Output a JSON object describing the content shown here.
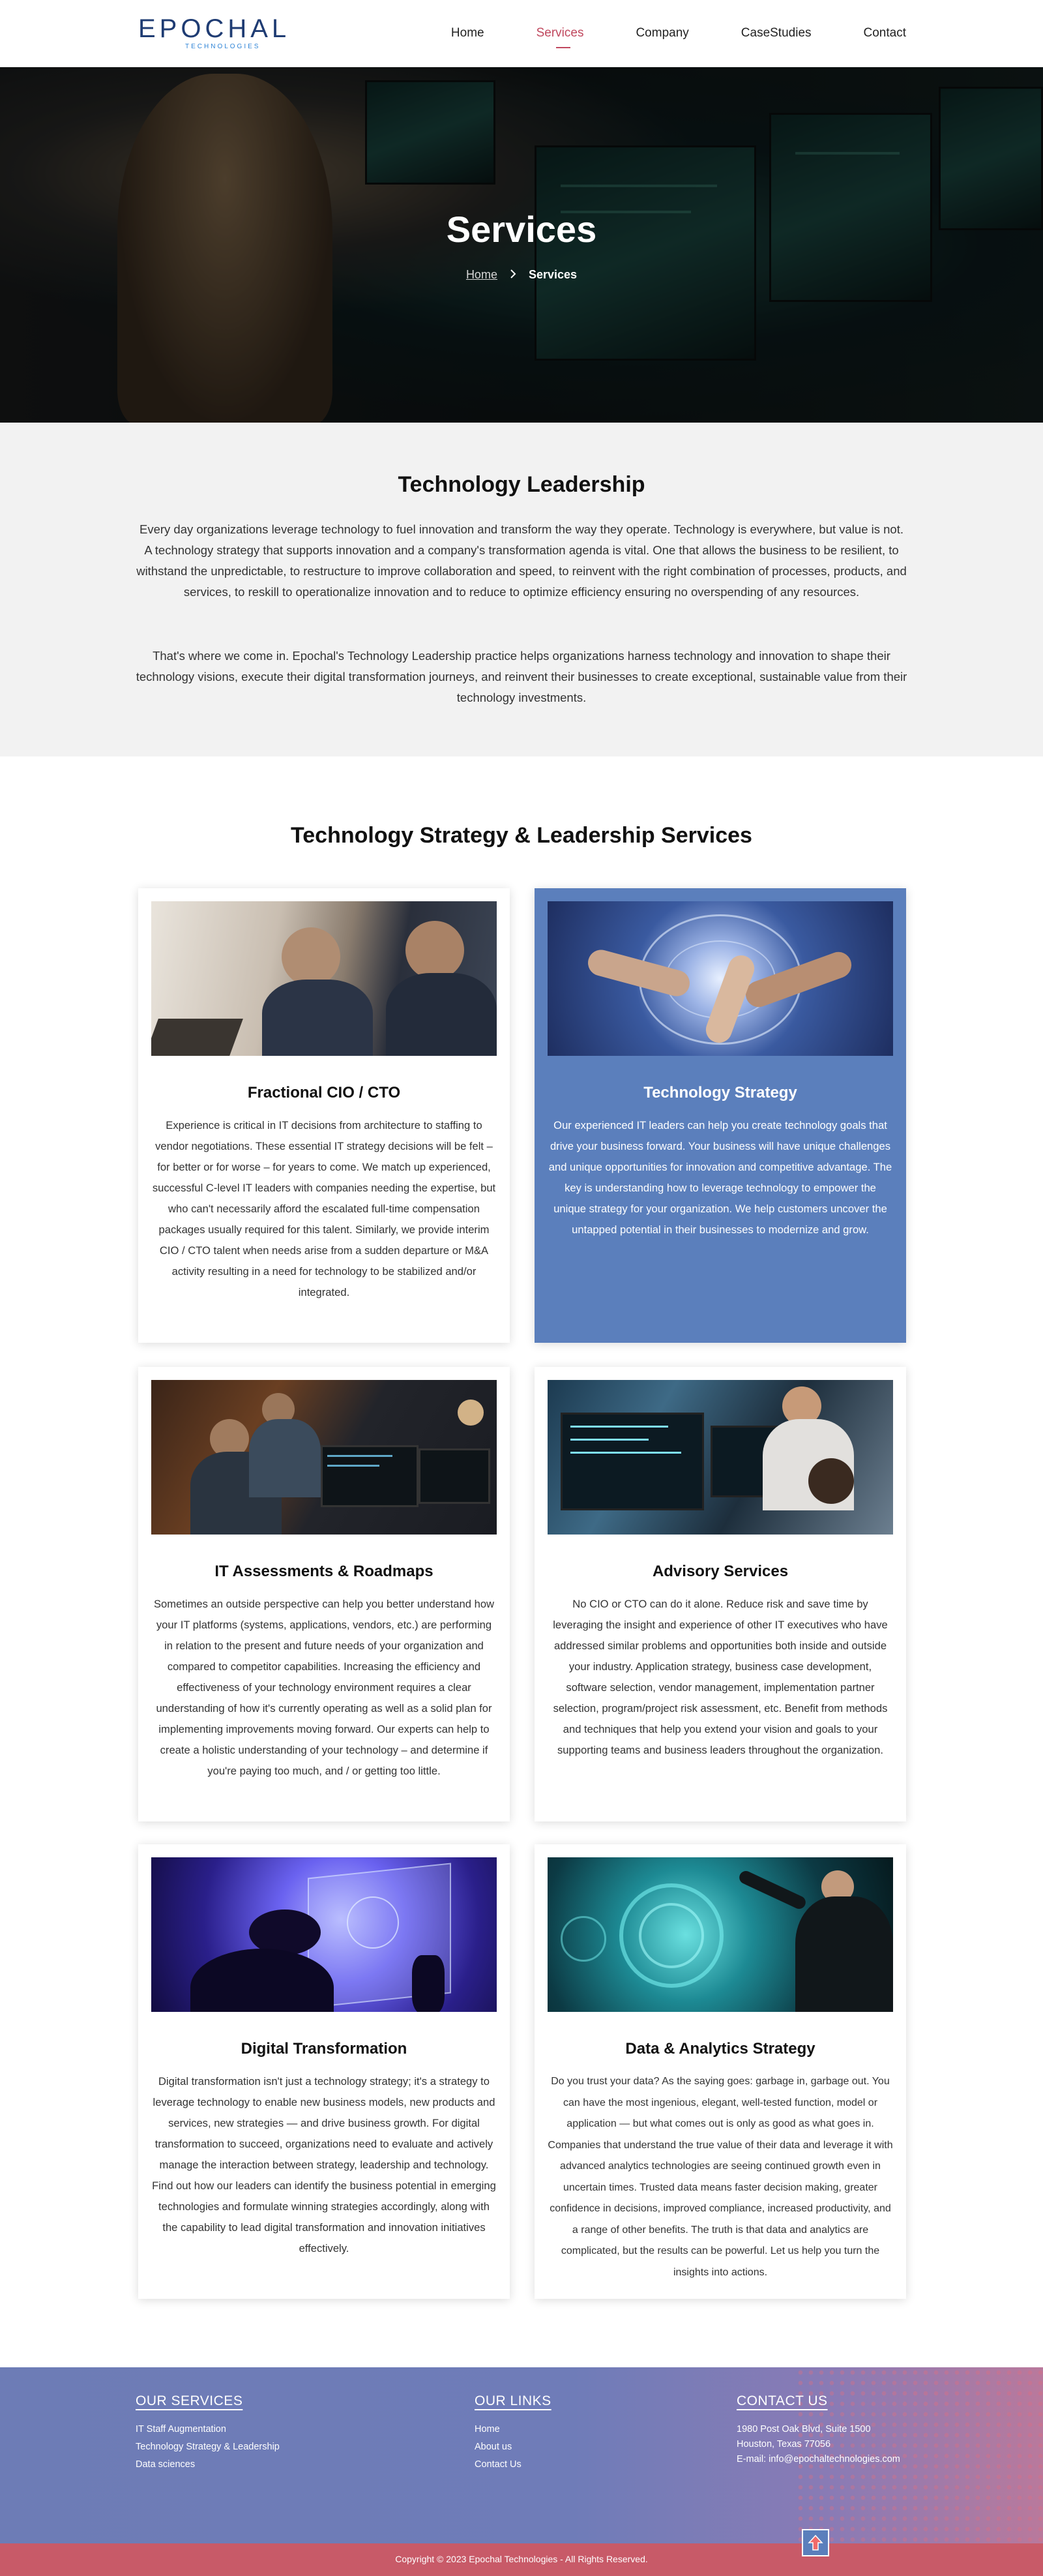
{
  "nav": {
    "logo_text": "EPOCHAL",
    "logo_sub": "TECHNOLOGIES",
    "items": [
      {
        "label": "Home"
      },
      {
        "label": "Services"
      },
      {
        "label": "Company"
      },
      {
        "label": "CaseStudies"
      },
      {
        "label": "Contact"
      }
    ],
    "active_index": 1
  },
  "hero": {
    "title": "Services",
    "breadcrumb_home": "Home",
    "breadcrumb_current": "Services"
  },
  "intro": {
    "heading": "Technology Leadership",
    "paragraph1": "Every day organizations leverage technology to fuel innovation and transform the way they operate.  Technology is everywhere, but value is not.  A technology strategy that supports innovation and a company's transformation agenda is vital.  One that allows the business to be resilient, to withstand the unpredictable, to restructure to improve collaboration and speed, to reinvent with the right combination of processes, products, and services, to reskill to operationalize innovation and to reduce to optimize efficiency ensuring no overspending of any resources.",
    "paragraph2": "That's where we come in.  Epochal's Technology Leadership practice helps organizations harness technology and innovation to shape their technology visions, execute their digital transformation journeys, and reinvent their businesses to create exceptional, sustainable value from their technology investments."
  },
  "services": {
    "heading": "Technology Strategy & Leadership Services",
    "cards": [
      {
        "title": "Fractional CIO / CTO",
        "text": "Experience is critical in IT decisions from architecture to staffing to vendor negotiations. These essential IT strategy decisions will be felt – for better or for worse – for years to come. We match up experienced, successful C-level IT leaders with companies needing the expertise, but who can't necessarily afford the escalated full-time compensation packages usually required for this talent. Similarly, we provide interim CIO / CTO talent when needs arise from a sudden departure or M&A activity resulting in a need for technology to be stabilized and/or integrated."
      },
      {
        "title": "Technology Strategy",
        "text": "Our experienced IT leaders can help you create technology goals that drive your business forward. Your business will have unique challenges and unique opportunities for innovation and competitive advantage. The key is understanding how to leverage technology to empower the unique strategy for your organization. We help customers uncover the untapped potential in their businesses to modernize and grow."
      },
      {
        "title": "IT Assessments & Roadmaps",
        "text": "Sometimes an outside perspective can help you better understand how your IT platforms (systems, applications, vendors, etc.) are performing in relation to the present and future needs of your organization and compared to competitor capabilities. Increasing the efficiency and effectiveness of your technology environment requires a clear understanding of how it's currently operating as well as a solid plan for implementing improvements moving forward. Our experts can help to create a holistic understanding of your technology – and determine if you're paying too much, and / or getting too little."
      },
      {
        "title": "Advisory Services",
        "text": "No CIO or CTO can do it alone. Reduce risk and save time by leveraging the insight and experience of other IT executives who have addressed similar problems and opportunities both inside and outside your industry. Application strategy, business case development, software selection, vendor management, implementation partner selection, program/project risk assessment, etc. Benefit from methods and techniques that help you extend your vision and goals to your supporting teams and business leaders throughout the organization."
      },
      {
        "title": "Digital Transformation",
        "text": "Digital transformation isn't just a technology strategy; it's a strategy to leverage technology to enable new business models, new products and services, new strategies — and drive business growth. For digital transformation to succeed, organizations need to evaluate and actively manage the interaction between strategy, leadership and technology. Find out how our leaders can identify the business potential in emerging technologies and formulate winning strategies accordingly, along with the capability to lead digital transformation and innovation initiatives effectively."
      },
      {
        "title": "Data & Analytics Strategy",
        "text": "Do you trust your data? As the saying goes: garbage in, garbage out. You can have the most ingenious, elegant, well-tested function, model or application — but what comes out is only as good as what goes in. Companies that understand the true value of their data and leverage it with advanced analytics technologies are seeing continued growth even in uncertain times. Trusted data means faster decision making, greater confidence in decisions, improved compliance, increased productivity, and a range of other benefits. The truth is that data and analytics are complicated, but the results can be powerful. Let us help you turn the insights into actions."
      }
    ]
  },
  "footer": {
    "services_heading": "OUR SERVICES",
    "services": [
      "IT Staff Augmentation",
      "Technology Strategy & Leadership",
      "Data sciences"
    ],
    "links_heading": "OUR LINKS",
    "links": [
      "Home",
      "About us",
      "Contact Us"
    ],
    "contact_heading": "CONTACT US",
    "address1": "1980 Post Oak Blvd, Suite 1500",
    "address2": "Houston, Texas 77056",
    "email": "E-mail: info@epochaltechnologies.com",
    "copyright": "Copyright © 2023 Epochal Technologies - All Rights Reserved."
  },
  "colors": {
    "accent_red": "#c0485e",
    "card_blue": "#5b7fbc",
    "footer_purple": "#6f7cb8",
    "copy_bar": "#c85a68"
  }
}
